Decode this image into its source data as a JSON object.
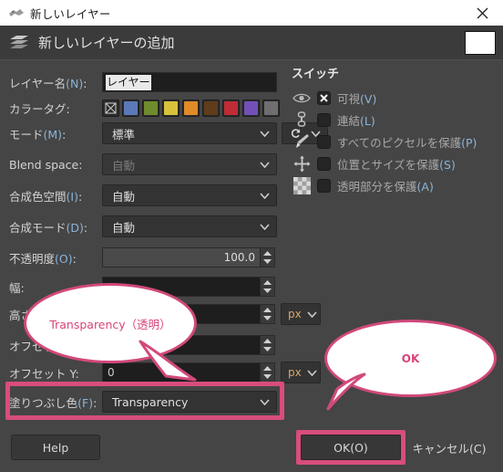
{
  "window": {
    "title": "新しいレイヤー",
    "close_icon": "close-icon"
  },
  "dialog": {
    "header_title": "新しいレイヤーの追加",
    "header_icon": "layers-icon",
    "preview_swatch_color": "#ffffff"
  },
  "form": {
    "layer_name": {
      "label": "レイヤー名(N):",
      "value": "レイヤー"
    },
    "color_tag": {
      "label": "カラータグ:",
      "swatches": [
        {
          "name": "none",
          "color": "#2c2c2c"
        },
        {
          "name": "blue",
          "color": "#5b78b8"
        },
        {
          "name": "green",
          "color": "#6e8c2d"
        },
        {
          "name": "yellow",
          "color": "#d8c23c"
        },
        {
          "name": "orange",
          "color": "#e08a28"
        },
        {
          "name": "brown",
          "color": "#5e3c1c"
        },
        {
          "name": "red",
          "color": "#bf2c36"
        },
        {
          "name": "violet",
          "color": "#7350b8"
        },
        {
          "name": "gray",
          "color": "#6e6e6e"
        }
      ]
    },
    "mode": {
      "label": "モード(M):",
      "value": "標準"
    },
    "blend_space": {
      "label": "Blend space:",
      "value": "自動",
      "disabled": true
    },
    "composite_space": {
      "label": "合成色空間(I):",
      "value": "自動"
    },
    "composite_mode": {
      "label": "合成モード(D):",
      "value": "自動"
    },
    "opacity": {
      "label": "不透明度(O):",
      "value": "100.0"
    },
    "width": {
      "label": "幅:",
      "value": ""
    },
    "height": {
      "label": "高さ:",
      "value": "",
      "unit": "px"
    },
    "offset_x": {
      "label": "オフセット X:",
      "value": ""
    },
    "offset_y": {
      "label": "オフセット Y:",
      "value": "0",
      "unit": "px"
    },
    "fill_color": {
      "label": "塗りつぶし色(F):",
      "value": "Transparency"
    }
  },
  "switches": {
    "title": "スイッチ",
    "items": [
      {
        "icon": "eye-icon",
        "label": "可視(V)",
        "checked": true
      },
      {
        "icon": "chain-link-icon",
        "label": "連結(L)",
        "checked": false
      },
      {
        "icon": "paintbrush-icon",
        "label": "すべてのピクセルを保護(P)",
        "checked": false
      },
      {
        "icon": "move-arrows-icon",
        "label": "位置とサイズを保護(S)",
        "checked": false
      },
      {
        "icon": "checkerboard-icon",
        "label": "透明部分を保護(A)",
        "checked": false
      }
    ]
  },
  "footer": {
    "help": "Help",
    "ok": "OK(O)",
    "cancel": "キャンセル(C)"
  },
  "annotations": {
    "accent_color": "#d84d7e",
    "bubble_fill": "Transparency（透明）",
    "bubble_ok": "OK"
  }
}
